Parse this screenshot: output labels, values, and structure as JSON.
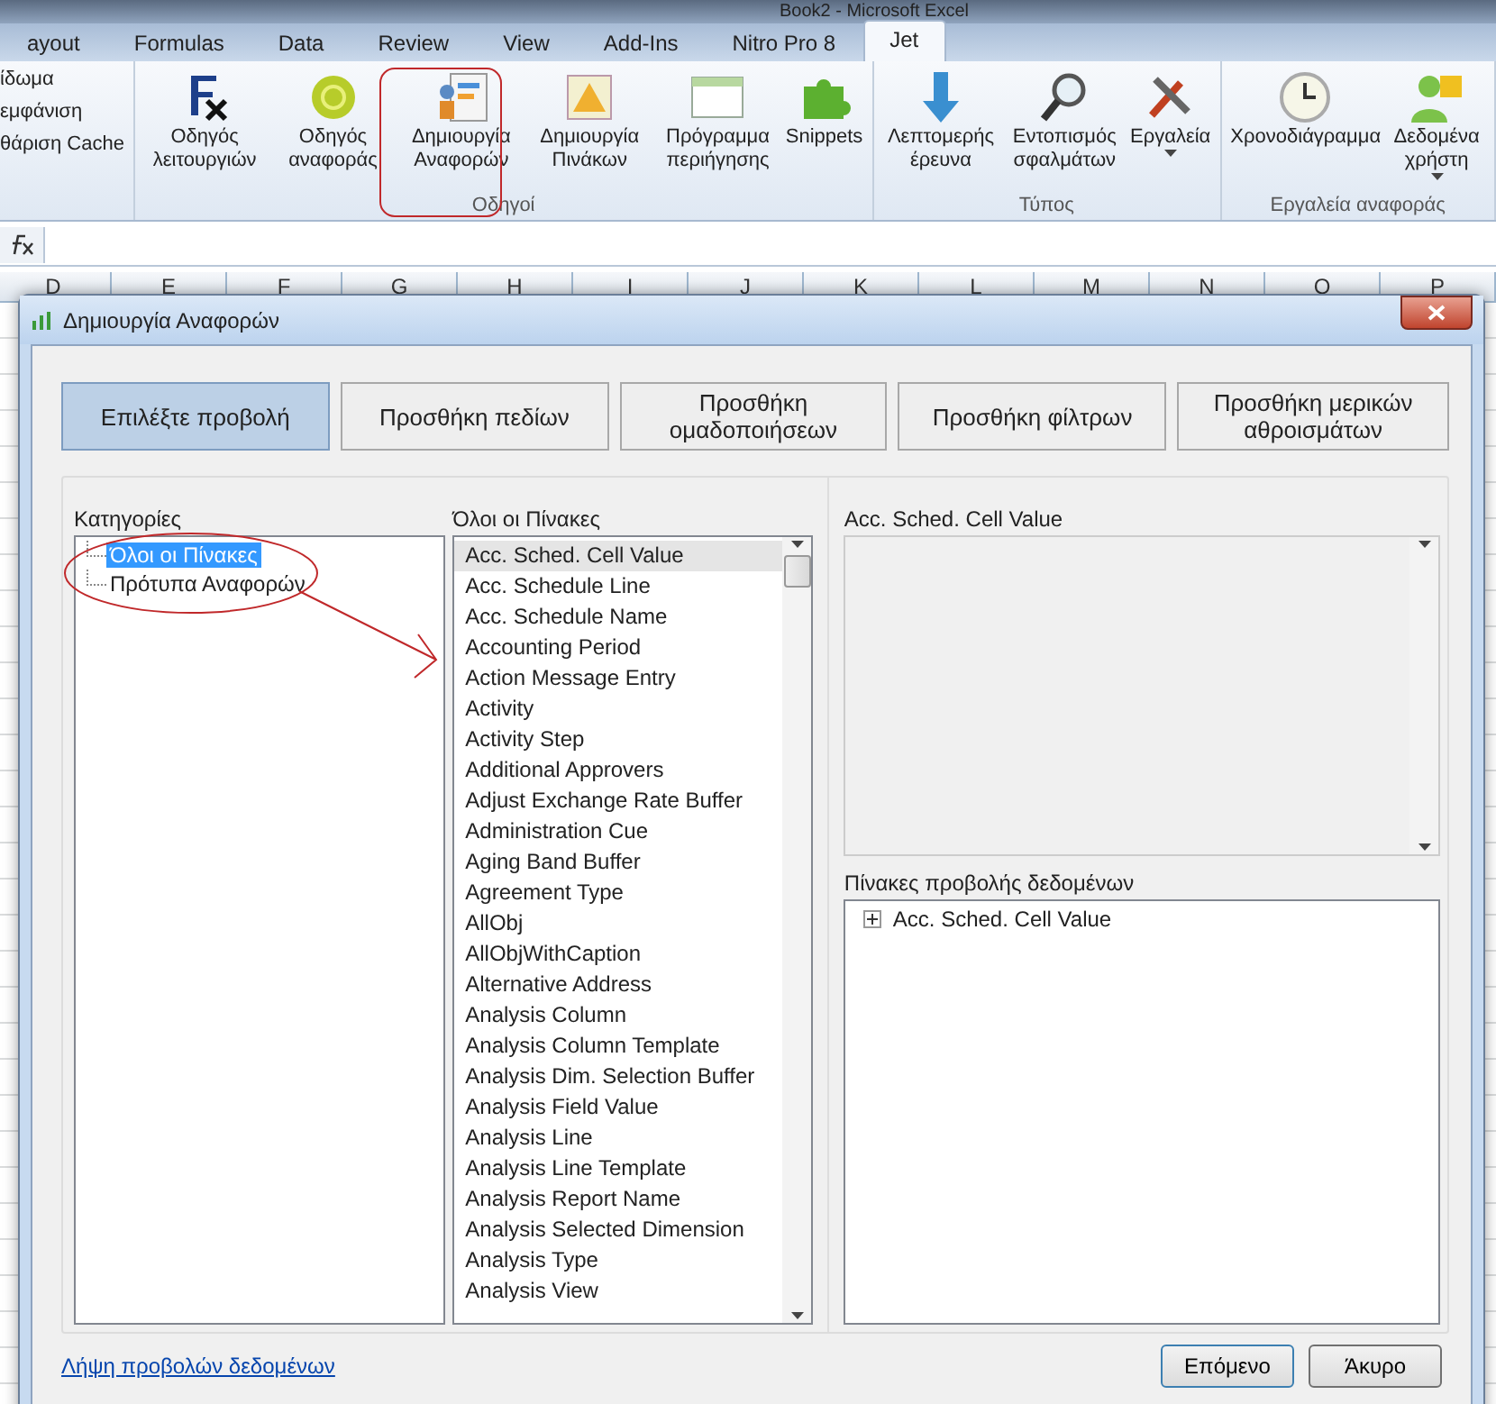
{
  "app_title": "Book2 - Microsoft Excel",
  "ribbon_tabs": [
    {
      "label": "ayout",
      "selected": false
    },
    {
      "label": "Formulas",
      "selected": false
    },
    {
      "label": "Data",
      "selected": false
    },
    {
      "label": "Review",
      "selected": false
    },
    {
      "label": "View",
      "selected": false
    },
    {
      "label": "Add-Ins",
      "selected": false
    },
    {
      "label": "Nitro Pro 8",
      "selected": false
    },
    {
      "label": "Jet",
      "selected": true
    }
  ],
  "ribbon_left_items": [
    "ίδωμα",
    "εμφάνιση",
    "θάριση Cache"
  ],
  "ribbon_groups": [
    {
      "title": "Οδηγοί",
      "buttons": [
        {
          "label": "Οδηγός λειτουργιών",
          "dropdown": false
        },
        {
          "label": "Οδηγός αναφοράς",
          "dropdown": false
        },
        {
          "label": "Δημιουργία Αναφορών",
          "dropdown": false
        },
        {
          "label": "Δημιουργία Πινάκων",
          "dropdown": false
        },
        {
          "label": "Πρόγραμμα περιήγησης",
          "dropdown": false
        },
        {
          "label": "Snippets",
          "dropdown": false
        }
      ]
    },
    {
      "title": "Τύπος",
      "buttons": [
        {
          "label": "Λεπτομερής έρευνα",
          "dropdown": false
        },
        {
          "label": "Εντοπισμός σφαλμάτων",
          "dropdown": false
        },
        {
          "label": "Εργαλεία",
          "dropdown": true
        }
      ]
    },
    {
      "title": "Εργαλεία αναφοράς",
      "buttons": [
        {
          "label": "Χρονοδιάγραμμα",
          "dropdown": false
        },
        {
          "label": "Δεδομένα χρήστη",
          "dropdown": true
        }
      ]
    }
  ],
  "column_headers": [
    "D",
    "E",
    "F",
    "G",
    "H",
    "I",
    "J",
    "K",
    "L",
    "M",
    "N",
    "O",
    "P"
  ],
  "dialog": {
    "title": "Δημιουργία Αναφορών",
    "steps": [
      {
        "label": "Επιλέξτε προβολή",
        "selected": true
      },
      {
        "label": "Προσθήκη πεδίων",
        "selected": false
      },
      {
        "label": "Προσθήκη ομαδοποιήσεων",
        "selected": false
      },
      {
        "label": "Προσθήκη φίλτρων",
        "selected": false
      },
      {
        "label": "Προσθήκη μερικών αθροισμάτων",
        "selected": false
      }
    ],
    "categories": {
      "label": "Κατηγορίες",
      "items": [
        {
          "label": "Όλοι οι Πίνακες",
          "selected": true
        },
        {
          "label": "Πρότυπα Αναφορών",
          "selected": false
        }
      ]
    },
    "tables": {
      "label": "Όλοι οι Πίνακες",
      "items": [
        {
          "label": "Acc. Sched. Cell Value",
          "selected": true
        },
        {
          "label": "Acc. Schedule Line",
          "selected": false
        },
        {
          "label": "Acc. Schedule Name",
          "selected": false
        },
        {
          "label": "Accounting Period",
          "selected": false
        },
        {
          "label": "Action Message Entry",
          "selected": false
        },
        {
          "label": "Activity",
          "selected": false
        },
        {
          "label": "Activity Step",
          "selected": false
        },
        {
          "label": "Additional Approvers",
          "selected": false
        },
        {
          "label": "Adjust Exchange Rate Buffer",
          "selected": false
        },
        {
          "label": "Administration Cue",
          "selected": false
        },
        {
          "label": "Aging Band Buffer",
          "selected": false
        },
        {
          "label": "Agreement Type",
          "selected": false
        },
        {
          "label": "AllObj",
          "selected": false
        },
        {
          "label": "AllObjWithCaption",
          "selected": false
        },
        {
          "label": "Alternative Address",
          "selected": false
        },
        {
          "label": "Analysis Column",
          "selected": false
        },
        {
          "label": "Analysis Column Template",
          "selected": false
        },
        {
          "label": "Analysis Dim. Selection Buffer",
          "selected": false
        },
        {
          "label": "Analysis Field Value",
          "selected": false
        },
        {
          "label": "Analysis Line",
          "selected": false
        },
        {
          "label": "Analysis Line Template",
          "selected": false
        },
        {
          "label": "Analysis Report Name",
          "selected": false
        },
        {
          "label": "Analysis Selected Dimension",
          "selected": false
        },
        {
          "label": "Analysis Type",
          "selected": false
        },
        {
          "label": "Analysis View",
          "selected": false
        }
      ]
    },
    "description_title": "Acc. Sched. Cell Value",
    "data_tables": {
      "label": "Πίνακες προβολής δεδομένων",
      "items": [
        {
          "label": "Acc. Sched. Cell Value",
          "expanded": false
        }
      ]
    },
    "link": "Λήψη προβολών δεδομένων",
    "buttons": [
      "Επόμενο",
      "Άκυρο"
    ]
  }
}
